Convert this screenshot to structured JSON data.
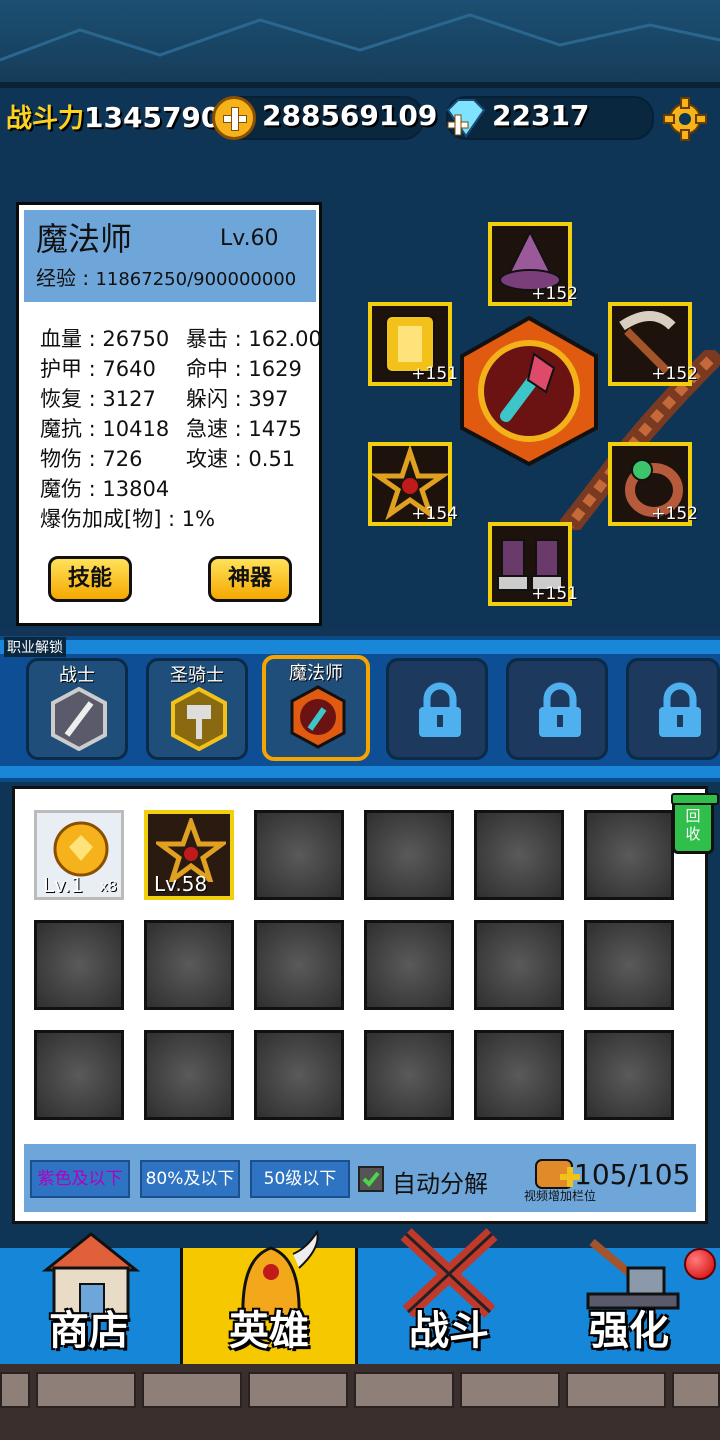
{
  "header": {
    "power_label": "战斗力",
    "power_value": "1345790",
    "gold_value": "288569109",
    "gem_value": "22317"
  },
  "hero": {
    "class_name": "魔法师",
    "level": "Lv.60",
    "exp_label": "经验",
    "exp_value": "11867250/900000000",
    "stats": {
      "hp": "血量 : 26750",
      "crit": "暴击 : 162.00",
      "armor": "护甲 : 7640",
      "hit": "命中 : 1629",
      "regen": "恢复 : 3127",
      "dodge": "躲闪 : 397",
      "mres": "魔抗 : 10418",
      "haste": "急速 : 1475",
      "patk": "物伤 : 726",
      "aspd": "攻速 : 0.51",
      "matk": "魔伤 : 13804",
      "critdmg": "爆伤加成[物] : 1%"
    },
    "skill_button": "技能",
    "artifact_button": "神器"
  },
  "equipment": {
    "hat_plus": "+152",
    "armor_plus": "+151",
    "weapon_plus": "+152",
    "amulet_plus": "+154",
    "ring_plus": "+152",
    "boots_plus": "+151"
  },
  "classes": {
    "unlock_label": "职业解锁",
    "items": [
      "战士",
      "圣骑士",
      "魔法师"
    ]
  },
  "inventory": {
    "recycle_label": "回收",
    "item1_level": "Lv.1",
    "item1_count": "x8",
    "item2_level": "Lv.58",
    "filter_purple": "紫色及以下",
    "filter_80": "80%及以下",
    "filter_50": "50级以下",
    "auto_decompose": "自动分解",
    "capacity": "105/105",
    "video_slot": "视频增加栏位"
  },
  "nav": {
    "shop": "商店",
    "hero": "英雄",
    "battle": "战斗",
    "upgrade": "强化"
  },
  "colors": {
    "accent_gold": "#f2cf0c",
    "panel_blue": "#6fa6da",
    "nav_active": "#f6c800",
    "nav_blue": "#1686d9"
  }
}
